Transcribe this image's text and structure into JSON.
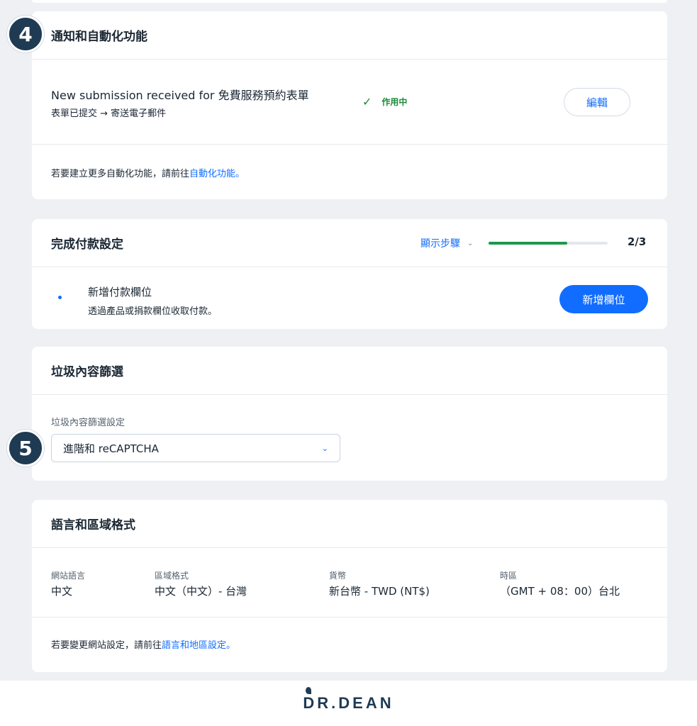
{
  "badges": {
    "step4": "4",
    "step5": "5"
  },
  "automation": {
    "title": "通知和自動化功能",
    "item_title": "New submission received for 免費服務預約表單",
    "item_sub": "表單已提交 → 寄送電子郵件",
    "status_icon": "check-icon",
    "status": "作用中",
    "edit_label": "編輯",
    "footer_prefix": "若要建立更多自動化功能，請前往",
    "footer_link": "自動化功能。"
  },
  "payment": {
    "title": "完成付款設定",
    "show_steps": "顯示步驟",
    "progress_text": "2/3",
    "progress_fraction": 0.66,
    "item_title": "新增付款欄位",
    "item_sub": "透過產品或捐款欄位收取付款。",
    "add_label": "新增欄位"
  },
  "spam": {
    "title": "垃圾內容篩選",
    "field_label": "垃圾內容篩選設定",
    "selected": "進階和 reCAPTCHA"
  },
  "language": {
    "title": "語言和區域格式",
    "columns": [
      {
        "label": "網站語言",
        "value": "中文"
      },
      {
        "label": "區域格式",
        "value": "中文（中文）- 台灣"
      },
      {
        "label": "貨幣",
        "value": "新台幣 - TWD (NT$)"
      },
      {
        "label": "時區",
        "value": "（GMT + 08：00）台北"
      }
    ],
    "footer_prefix": "若要變更網站設定，請前往",
    "footer_link": "語言和地區設定。"
  },
  "logo": {
    "text": "DR.DEAN"
  },
  "colors": {
    "accent": "#116dff",
    "success": "#1a8a3a",
    "badge": "#1f3b53",
    "background": "#eef0f4"
  }
}
